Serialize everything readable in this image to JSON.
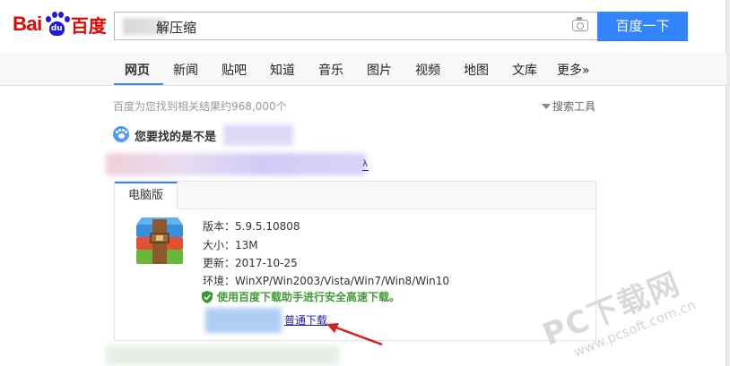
{
  "header": {
    "logo_text_latin": "Bai",
    "logo_paw_text": "du",
    "logo_text_cn": "百度",
    "search_value": "解压缩",
    "search_button": "百度一下"
  },
  "nav": {
    "items": [
      "网页",
      "新闻",
      "贴吧",
      "知道",
      "音乐",
      "图片",
      "视频",
      "地图",
      "文库",
      "更多»"
    ],
    "active": "网页"
  },
  "results": {
    "count_text": "百度为您找到相关结果约968,000个",
    "tools_label": "搜索工具",
    "suggest_label": "您要找的是不是",
    "title_tail": "λ"
  },
  "download_card": {
    "tab_label": "电脑版",
    "version": "版本：5.9.5.10808",
    "size": "大小：13M",
    "updated": "更新：2017-10-25",
    "environment": "环境：WinXP/Win2003/Vista/Win7/Win8/Win10",
    "safe_download": "使用百度下载助手进行安全高速下载。",
    "normal_download": "普通下载"
  },
  "watermark": {
    "big": "PC下载网",
    "small": "www.pcsoft.com.cn"
  },
  "colors": {
    "brand_red": "#e10601",
    "brand_blue": "#2319dc",
    "button_blue": "#3385ff",
    "safe_green": "#3d9932",
    "link": "#1a1aa6",
    "arrow_red": "#d42020"
  }
}
